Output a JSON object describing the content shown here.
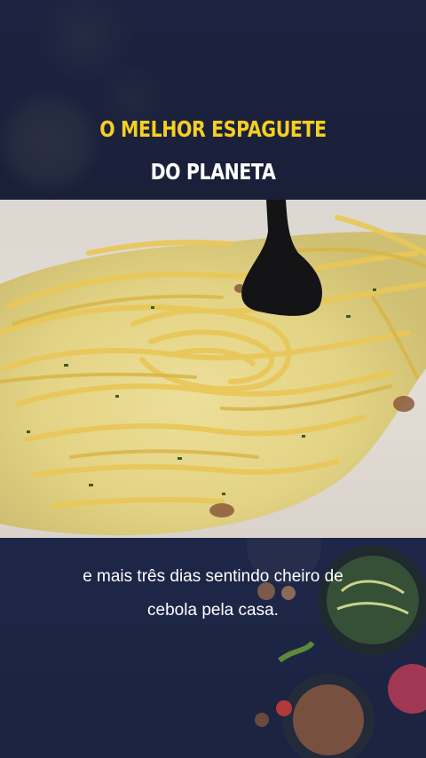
{
  "title": {
    "line1": "O MELHOR ESPAGUETE",
    "line2": "DO PLANETA"
  },
  "caption": {
    "line1": "e mais três dias sentindo cheiro de",
    "line2": "cebola pela casa."
  },
  "colors": {
    "title_accent": "#f5cf22",
    "title_secondary": "#ffffff",
    "background": "#1b2240"
  }
}
